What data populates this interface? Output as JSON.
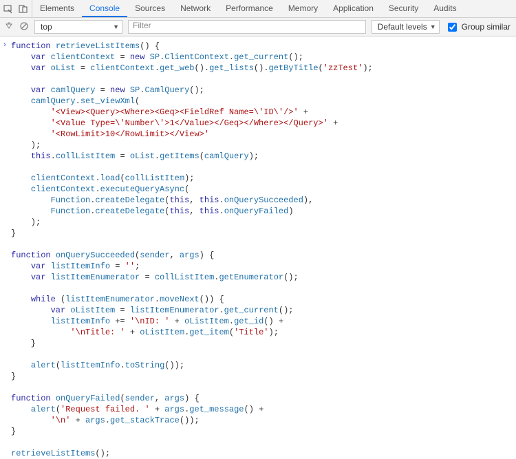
{
  "tabs": [
    "Elements",
    "Console",
    "Sources",
    "Network",
    "Performance",
    "Memory",
    "Application",
    "Security",
    "Audits"
  ],
  "active_tab": 1,
  "context": "top",
  "filter_placeholder": "Filter",
  "levels_label": "Default levels",
  "group_similar_label": "Group similar",
  "code": {
    "t": {
      "fn": "function",
      "var": "var",
      "new": "new",
      "this": "this",
      "while": "while",
      "retrieveListItems": "retrieveListItems",
      "onQuerySucceeded": "onQuerySucceeded",
      "onQueryFailed": "onQueryFailed",
      "clientContext": "clientContext",
      "SP": "SP",
      "ClientContext": "ClientContext",
      "get_current": "get_current",
      "oList": "oList",
      "get_web": "get_web",
      "get_lists": "get_lists",
      "getByTitle": "getByTitle",
      "camlQuery": "camlQuery",
      "CamlQuery": "CamlQuery",
      "set_viewXml": "set_viewXml",
      "collListItem": "collListItem",
      "getItems": "getItems",
      "load": "load",
      "executeQueryAsync": "executeQueryAsync",
      "Function": "Function",
      "createDelegate": "createDelegate",
      "sender": "sender",
      "args": "args",
      "listItemInfo": "listItemInfo",
      "listItemEnumerator": "listItemEnumerator",
      "getEnumerator": "getEnumerator",
      "moveNext": "moveNext",
      "oListItem": "oListItem",
      "get_id": "get_id",
      "get_item": "get_item",
      "alert": "alert",
      "toString": "toString",
      "get_message": "get_message",
      "get_stackTrace": "get_stackTrace",
      "str_zzTest": "'zzTest'",
      "str_view1": "'<View><Query><Where><Geq><FieldRef Name=\\'ID\\'/>'",
      "str_view2": "'<Value Type=\\'Number\\'>1</Value></Geq></Where></Query>'",
      "str_view3": "'<RowLimit>10</RowLimit></View>'",
      "str_empty": "''",
      "str_nID": "'\\nID: '",
      "str_nTitle": "'\\nTitle: '",
      "str_Title": "'Title'",
      "str_reqfail": "'Request failed. '",
      "str_nl": "'\\n'"
    }
  }
}
